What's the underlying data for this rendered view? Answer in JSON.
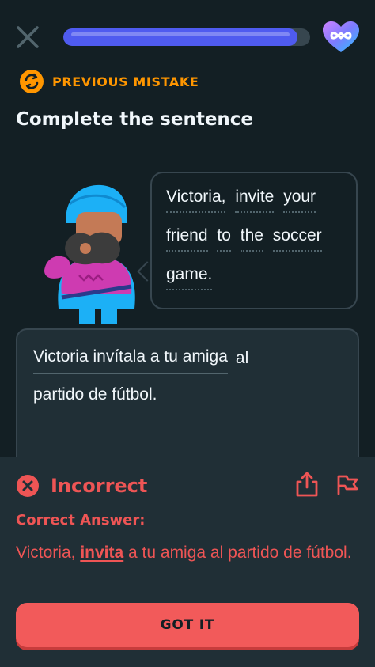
{
  "header": {
    "close_icon": "close-icon",
    "progress_fraction": 0.95,
    "hearts_icon": "infinite-hearts-icon"
  },
  "badge": {
    "icon": "refresh-icon",
    "label": "PREVIOUS MISTAKE",
    "color": "#ff9600"
  },
  "title": "Complete the sentence",
  "prompt": {
    "lines": [
      [
        "Victoria,",
        "invite",
        "your"
      ],
      [
        "friend",
        "to",
        "the",
        "soccer"
      ],
      [
        "game."
      ]
    ]
  },
  "answer": {
    "input_value": "Victoria invítala a tu amiga",
    "after_input": "al",
    "line2": "partido de fútbol."
  },
  "feedback": {
    "status": "Incorrect",
    "status_icon": "x-circle-icon",
    "correct_label": "Correct Answer:",
    "correct_prefix": "Victoria, ",
    "correct_highlight": "invita",
    "correct_suffix": " a tu amiga al partido de fútbol.",
    "share_icon": "share-icon",
    "flag_icon": "flag-icon",
    "button_label": "GOT IT",
    "accent": "#ee5555"
  }
}
